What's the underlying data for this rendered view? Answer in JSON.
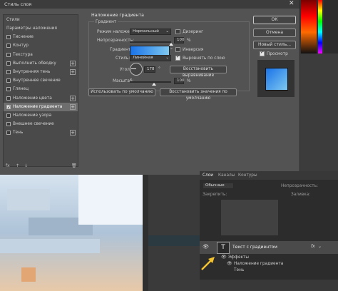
{
  "dialog": {
    "title": "Стиль слоя",
    "close_glyph": "✕",
    "left_panel": {
      "header": "Стили",
      "items": [
        {
          "label": "Параметры наложения",
          "checkbox": false,
          "checked": false,
          "plus": false
        },
        {
          "label": "Тиснение",
          "checkbox": true,
          "checked": false,
          "plus": false
        },
        {
          "label": "Контур",
          "checkbox": true,
          "checked": false,
          "plus": false
        },
        {
          "label": "Текстура",
          "checkbox": true,
          "checked": false,
          "plus": false
        },
        {
          "label": "Выполнить обводку",
          "checkbox": true,
          "checked": false,
          "plus": true
        },
        {
          "label": "Внутренняя тень",
          "checkbox": true,
          "checked": false,
          "plus": true
        },
        {
          "label": "Внутреннее свечение",
          "checkbox": true,
          "checked": false,
          "plus": false
        },
        {
          "label": "Глянец",
          "checkbox": true,
          "checked": false,
          "plus": false
        },
        {
          "label": "Наложение цвета",
          "checkbox": true,
          "checked": false,
          "plus": true
        },
        {
          "label": "Наложение градиента",
          "checkbox": true,
          "checked": true,
          "plus": true,
          "selected": true
        },
        {
          "label": "Наложение узора",
          "checkbox": true,
          "checked": false,
          "plus": false
        },
        {
          "label": "Внешнее свечение",
          "checkbox": true,
          "checked": false,
          "plus": false
        },
        {
          "label": "Тень",
          "checkbox": true,
          "checked": false,
          "plus": true
        }
      ],
      "footer_icons": [
        "fx",
        "↑",
        "↓",
        "🗑"
      ]
    },
    "gradient": {
      "section_title": "Наложение градиента",
      "group_title": "Градиент",
      "blend_mode_label": "Режим наложения:",
      "blend_mode_value": "Нормальный",
      "dither_label": "Дизеринг",
      "opacity_label": "Непрозрачность:",
      "opacity_value": "100",
      "opacity_unit": "%",
      "gradient_label": "Градиент:",
      "reverse_label": "Инверсия",
      "style_label": "Стиль:",
      "style_value": "Линейная",
      "align_label": "Выровнять по слою",
      "angle_label": "Угол:",
      "angle_value": "178",
      "angle_unit": "°",
      "reset_align_label": "Восстановить выравнивание",
      "scale_label": "Масштаб:",
      "scale_value": "100",
      "scale_unit": "%",
      "make_default_label": "Использовать по умолчанию",
      "reset_default_label": "Восстановить значения по умолчанию"
    },
    "actions": {
      "ok": "ОК",
      "cancel": "Отмена",
      "new_style": "Новый стиль...",
      "preview_label": "Просмотр"
    }
  },
  "layers_panel": {
    "tabs": [
      "Слои",
      "Каналы",
      "Контуры"
    ],
    "kind_label": "Обычные",
    "opacity_label": "Непрозрачность:",
    "fill_label": "Заливка:",
    "lock_label": "Закрепить:",
    "layer_name": "Текст с градиентом",
    "fx_label": "fx",
    "effects_label": "Эффекты",
    "effect_item": "Наложение градиента",
    "shadow_item": "Тень",
    "thumb_glyph": "T"
  },
  "colors": {
    "gradient_start": "#1a73e8",
    "gradient_end": "#7ec8f0",
    "accent_arrow": "#f2c230"
  }
}
